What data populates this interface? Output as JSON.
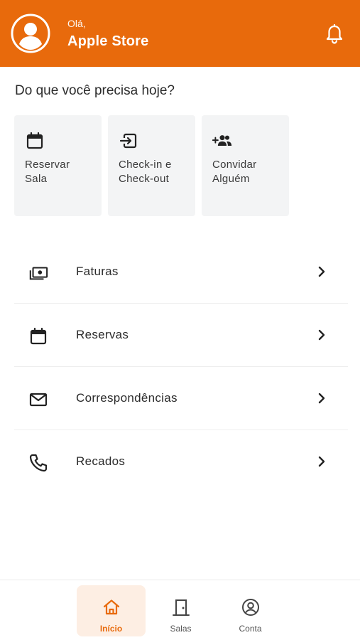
{
  "header": {
    "greeting": "Olá,",
    "store_name": "Apple Store",
    "avatar_icon": "user-circle-icon",
    "notification_icon": "bell-icon",
    "background_color": "#e86a0c"
  },
  "quick_actions": {
    "title": "Do que você precisa hoje?",
    "items": [
      {
        "icon": "calendar-icon",
        "line1": "Reservar",
        "line2": "Sala"
      },
      {
        "icon": "check-in-icon",
        "line1": "Check-in e",
        "line2": "Check-out"
      },
      {
        "icon": "invite-people-icon",
        "line1": "Convidar",
        "line2": "Alguém"
      }
    ]
  },
  "menu": {
    "items": [
      {
        "icon": "money-icon",
        "label": "Faturas"
      },
      {
        "icon": "calendar-icon",
        "label": "Reservas"
      },
      {
        "icon": "mail-icon",
        "label": "Correspondências"
      },
      {
        "icon": "phone-icon",
        "label": "Recados"
      }
    ]
  },
  "bottom_nav": {
    "items": [
      {
        "icon": "home-icon",
        "label": "Início",
        "active": true
      },
      {
        "icon": "door-icon",
        "label": "Salas",
        "active": false
      },
      {
        "icon": "account-circle-icon",
        "label": "Conta",
        "active": false
      }
    ],
    "accent_color": "#e86a0c",
    "active_bg": "#fdeee3"
  }
}
